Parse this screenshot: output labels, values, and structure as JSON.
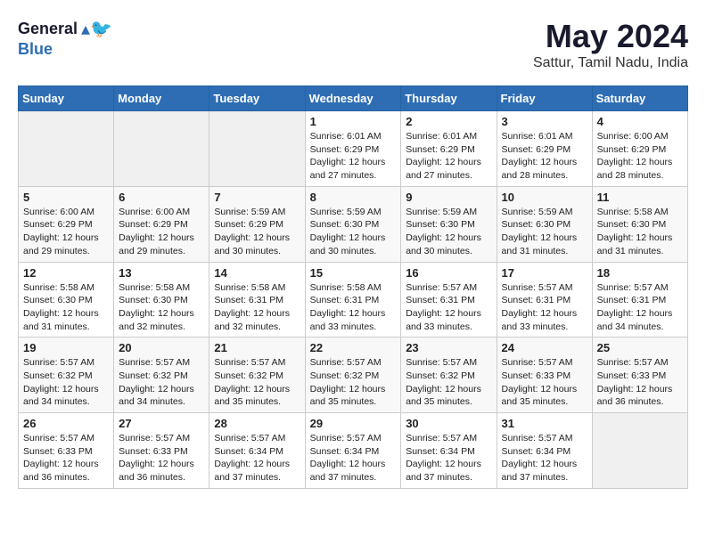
{
  "logo": {
    "general": "General",
    "blue": "Blue"
  },
  "title": "May 2024",
  "location": "Sattur, Tamil Nadu, India",
  "weekdays": [
    "Sunday",
    "Monday",
    "Tuesday",
    "Wednesday",
    "Thursday",
    "Friday",
    "Saturday"
  ],
  "weeks": [
    [
      {
        "day": "",
        "info": ""
      },
      {
        "day": "",
        "info": ""
      },
      {
        "day": "",
        "info": ""
      },
      {
        "day": "1",
        "info": "Sunrise: 6:01 AM\nSunset: 6:29 PM\nDaylight: 12 hours and 27 minutes."
      },
      {
        "day": "2",
        "info": "Sunrise: 6:01 AM\nSunset: 6:29 PM\nDaylight: 12 hours and 27 minutes."
      },
      {
        "day": "3",
        "info": "Sunrise: 6:01 AM\nSunset: 6:29 PM\nDaylight: 12 hours and 28 minutes."
      },
      {
        "day": "4",
        "info": "Sunrise: 6:00 AM\nSunset: 6:29 PM\nDaylight: 12 hours and 28 minutes."
      }
    ],
    [
      {
        "day": "5",
        "info": "Sunrise: 6:00 AM\nSunset: 6:29 PM\nDaylight: 12 hours and 29 minutes."
      },
      {
        "day": "6",
        "info": "Sunrise: 6:00 AM\nSunset: 6:29 PM\nDaylight: 12 hours and 29 minutes."
      },
      {
        "day": "7",
        "info": "Sunrise: 5:59 AM\nSunset: 6:29 PM\nDaylight: 12 hours and 30 minutes."
      },
      {
        "day": "8",
        "info": "Sunrise: 5:59 AM\nSunset: 6:30 PM\nDaylight: 12 hours and 30 minutes."
      },
      {
        "day": "9",
        "info": "Sunrise: 5:59 AM\nSunset: 6:30 PM\nDaylight: 12 hours and 30 minutes."
      },
      {
        "day": "10",
        "info": "Sunrise: 5:59 AM\nSunset: 6:30 PM\nDaylight: 12 hours and 31 minutes."
      },
      {
        "day": "11",
        "info": "Sunrise: 5:58 AM\nSunset: 6:30 PM\nDaylight: 12 hours and 31 minutes."
      }
    ],
    [
      {
        "day": "12",
        "info": "Sunrise: 5:58 AM\nSunset: 6:30 PM\nDaylight: 12 hours and 31 minutes."
      },
      {
        "day": "13",
        "info": "Sunrise: 5:58 AM\nSunset: 6:30 PM\nDaylight: 12 hours and 32 minutes."
      },
      {
        "day": "14",
        "info": "Sunrise: 5:58 AM\nSunset: 6:31 PM\nDaylight: 12 hours and 32 minutes."
      },
      {
        "day": "15",
        "info": "Sunrise: 5:58 AM\nSunset: 6:31 PM\nDaylight: 12 hours and 33 minutes."
      },
      {
        "day": "16",
        "info": "Sunrise: 5:57 AM\nSunset: 6:31 PM\nDaylight: 12 hours and 33 minutes."
      },
      {
        "day": "17",
        "info": "Sunrise: 5:57 AM\nSunset: 6:31 PM\nDaylight: 12 hours and 33 minutes."
      },
      {
        "day": "18",
        "info": "Sunrise: 5:57 AM\nSunset: 6:31 PM\nDaylight: 12 hours and 34 minutes."
      }
    ],
    [
      {
        "day": "19",
        "info": "Sunrise: 5:57 AM\nSunset: 6:32 PM\nDaylight: 12 hours and 34 minutes."
      },
      {
        "day": "20",
        "info": "Sunrise: 5:57 AM\nSunset: 6:32 PM\nDaylight: 12 hours and 34 minutes."
      },
      {
        "day": "21",
        "info": "Sunrise: 5:57 AM\nSunset: 6:32 PM\nDaylight: 12 hours and 35 minutes."
      },
      {
        "day": "22",
        "info": "Sunrise: 5:57 AM\nSunset: 6:32 PM\nDaylight: 12 hours and 35 minutes."
      },
      {
        "day": "23",
        "info": "Sunrise: 5:57 AM\nSunset: 6:32 PM\nDaylight: 12 hours and 35 minutes."
      },
      {
        "day": "24",
        "info": "Sunrise: 5:57 AM\nSunset: 6:33 PM\nDaylight: 12 hours and 35 minutes."
      },
      {
        "day": "25",
        "info": "Sunrise: 5:57 AM\nSunset: 6:33 PM\nDaylight: 12 hours and 36 minutes."
      }
    ],
    [
      {
        "day": "26",
        "info": "Sunrise: 5:57 AM\nSunset: 6:33 PM\nDaylight: 12 hours and 36 minutes."
      },
      {
        "day": "27",
        "info": "Sunrise: 5:57 AM\nSunset: 6:33 PM\nDaylight: 12 hours and 36 minutes."
      },
      {
        "day": "28",
        "info": "Sunrise: 5:57 AM\nSunset: 6:34 PM\nDaylight: 12 hours and 37 minutes."
      },
      {
        "day": "29",
        "info": "Sunrise: 5:57 AM\nSunset: 6:34 PM\nDaylight: 12 hours and 37 minutes."
      },
      {
        "day": "30",
        "info": "Sunrise: 5:57 AM\nSunset: 6:34 PM\nDaylight: 12 hours and 37 minutes."
      },
      {
        "day": "31",
        "info": "Sunrise: 5:57 AM\nSunset: 6:34 PM\nDaylight: 12 hours and 37 minutes."
      },
      {
        "day": "",
        "info": ""
      }
    ]
  ]
}
